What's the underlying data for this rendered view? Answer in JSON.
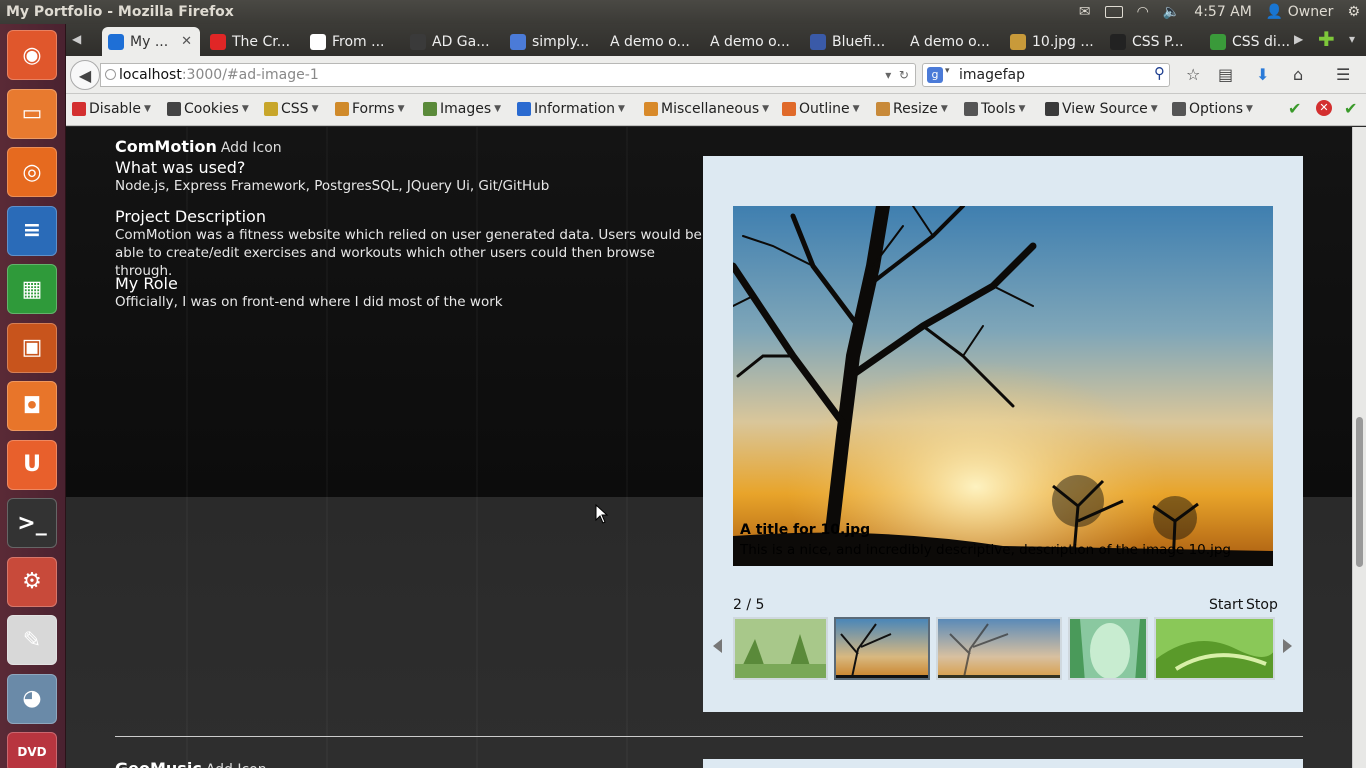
{
  "os_panel": {
    "window_title": "My Portfolio - Mozilla Firefox",
    "time": "4:57 AM",
    "user": "Owner"
  },
  "launcher": {
    "items": [
      {
        "name": "ubuntu-dash",
        "glyph": "◉",
        "color": "#e0572c"
      },
      {
        "name": "files",
        "glyph": "▭",
        "color": "#e87a2f"
      },
      {
        "name": "firefox",
        "glyph": "◎",
        "color": "#e66a1f"
      },
      {
        "name": "writer",
        "glyph": "≡",
        "color": "#2a6bb8"
      },
      {
        "name": "calc",
        "glyph": "▦",
        "color": "#2f9a3a"
      },
      {
        "name": "impress",
        "glyph": "▣",
        "color": "#c8541c"
      },
      {
        "name": "software-center",
        "glyph": "◘",
        "color": "#e8752a"
      },
      {
        "name": "ubuntu-one",
        "glyph": "U",
        "color": "#e8602c"
      },
      {
        "name": "terminal",
        "glyph": ">_",
        "color": "#333333"
      },
      {
        "name": "system-settings",
        "glyph": "⚙",
        "color": "#c84a3a"
      },
      {
        "name": "text-editor",
        "glyph": "✎",
        "color": "#d8d8d8"
      },
      {
        "name": "gimp",
        "glyph": "◕",
        "color": "#6a8aa8"
      },
      {
        "name": "dvd",
        "glyph": "DVD",
        "color": "#b8353f"
      }
    ]
  },
  "tabs": [
    {
      "label": "My ...",
      "favicon_color": "#1e6fd6",
      "active": true,
      "close": "✕"
    },
    {
      "label": "The Cr...",
      "favicon_color": "#e02626"
    },
    {
      "label": "From ...",
      "favicon_color": "#ffffff"
    },
    {
      "label": "AD Ga...",
      "favicon_color": "#3a3a3a"
    },
    {
      "label": "simply...",
      "favicon_color": "#4b7bd8"
    },
    {
      "label": "A demo o...",
      "favicon_color": ""
    },
    {
      "label": "A demo o...",
      "favicon_color": ""
    },
    {
      "label": "Bluefi...",
      "favicon_color": "#3a5aa8"
    },
    {
      "label": "A demo o...",
      "favicon_color": ""
    },
    {
      "label": "10.jpg ...",
      "favicon_color": "#c89a3a"
    },
    {
      "label": "CSS P...",
      "favicon_color": "#222222"
    },
    {
      "label": "CSS di...",
      "favicon_color": "#3a9a3a"
    }
  ],
  "navbar": {
    "url_host": "localhost",
    "url_path": ":3000/#ad-image-1",
    "search_value": "imagefap"
  },
  "devbar": [
    {
      "label": "Disable",
      "icon_color": "#d32f2f"
    },
    {
      "label": "Cookies",
      "icon_color": "#444444"
    },
    {
      "label": "CSS",
      "icon_color": "#c8a62a"
    },
    {
      "label": "Forms",
      "icon_color": "#d08a2a"
    },
    {
      "label": "Images",
      "icon_color": "#5a8a3a"
    },
    {
      "label": "Information",
      "icon_color": "#2a6ad0"
    },
    {
      "label": "Miscellaneous",
      "icon_color": "#d88a2a"
    },
    {
      "label": "Outline",
      "icon_color": "#e06a2a"
    },
    {
      "label": "Resize",
      "icon_color": "#c88a3a"
    },
    {
      "label": "Tools",
      "icon_color": "#555555"
    },
    {
      "label": "View Source",
      "icon_color": "#3a3a3a"
    },
    {
      "label": "Options",
      "icon_color": "#555555"
    }
  ],
  "project": {
    "title": "ComMotion",
    "add_icon": "Add Icon",
    "used_heading": "What was used?",
    "used_text": "Node.js, Express Framework, PostgresSQL, JQuery Ui, Git/GitHub",
    "desc_heading": "Project Description",
    "desc_text": "ComMotion was a fitness website which relied on user generated data. Users would be able to create/edit exercises and workouts which other users could then browse through.",
    "role_heading": "My Role",
    "role_text": "Officially, I was on front-end where I did most of the work"
  },
  "gallery": {
    "caption_title": "A title for 10.jpg",
    "caption_desc": "This is a nice, and incredibly descriptive, description of the image 10.jpg",
    "counter": "2 / 5",
    "start": "Start",
    "stop": "Stop",
    "active_thumb": 2
  },
  "next_project": {
    "title": "GeoMusic",
    "add_icon": "Add Icon"
  }
}
